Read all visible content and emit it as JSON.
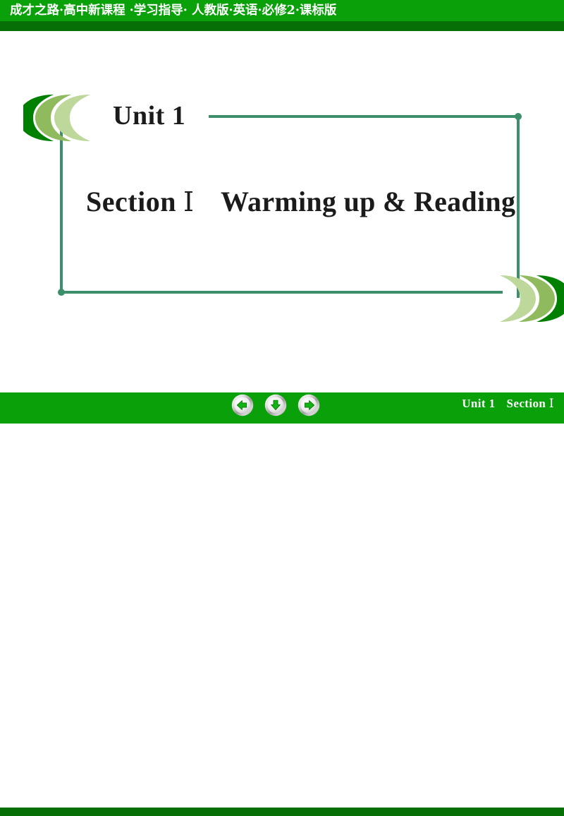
{
  "header": {
    "title": "成才之路·高中新课程 ·学习指导· 人教版·英语·必修2·课标版",
    "bar_color": "#0aa00a",
    "shadow_color": "#067006",
    "text_color": "#ffffff"
  },
  "slide": {
    "unit_title": "Unit 1",
    "section_label": "Section",
    "section_numeral": "Ⅰ",
    "section_topic": "Warming up & Reading",
    "frame_color": "#3d8f6b",
    "title_color": "#1b1b1b"
  },
  "decorations": {
    "top_left_chevrons": {
      "name": "chevron-cluster-left",
      "direction": "left",
      "colors": [
        "#008000",
        "#8fba5e",
        "#bed79b"
      ]
    },
    "bottom_right_chevrons": {
      "name": "chevron-cluster-right",
      "direction": "right",
      "colors": [
        "#008000",
        "#8fba5e",
        "#bed79b"
      ]
    }
  },
  "footer": {
    "bar_color": "#0aa00a",
    "shadow_color": "#067006",
    "nav": [
      {
        "name": "previous-slide-button",
        "icon": "arrow-left-icon",
        "label": "Previous"
      },
      {
        "name": "down-slide-button",
        "icon": "arrow-down-icon",
        "label": "Down"
      },
      {
        "name": "next-slide-button",
        "icon": "arrow-right-icon",
        "label": "Next"
      }
    ],
    "breadcrumb_unit": "Unit 1",
    "breadcrumb_section_label": "Section",
    "breadcrumb_section_numeral": "Ⅰ",
    "text_color": "#ffffff"
  }
}
